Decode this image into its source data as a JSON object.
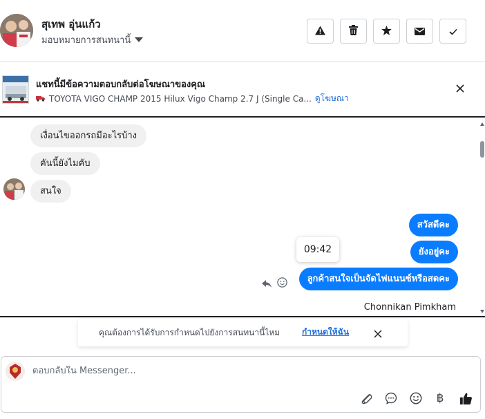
{
  "header": {
    "contact_name": "สุเทพ อุ่นแก้ว",
    "assign_label": "มอบหมายการสนทนานี้",
    "actions": [
      {
        "name": "report",
        "icon": "warning-icon"
      },
      {
        "name": "delete",
        "icon": "trash-icon"
      },
      {
        "name": "star",
        "icon": "star-icon"
      },
      {
        "name": "mark-unread",
        "icon": "envelope-icon"
      },
      {
        "name": "mark-done",
        "icon": "check-icon"
      }
    ]
  },
  "ad_banner": {
    "title": "แชทนี้มีข้อความตอบกลับต่อโฆษณาของคุณ",
    "subtitle": "TOYOTA VIGO CHAMP 2015 Hilux Vigo Champ 2.7 J (Single Ca...",
    "link": "ดูโฆษณา"
  },
  "messages": {
    "incoming": [
      "เงื่อนไขออกรถมีอะไรบ้าง",
      "คันนี้ยังไมคับ",
      "สนใจ"
    ],
    "outgoing": [
      "สวัสดีคะ",
      "ยังอยู่คะ",
      "ลูกค้าสนใจเป็นจัดไฟแนนซ์หรือสดคะ"
    ],
    "timestamp": "09:42",
    "sender_name": "Chonnikan Pimkham"
  },
  "toast": {
    "text": "คุณต้องการได้รับการกำหนดไปยังการสนทนานี้ไหม",
    "link": "กำหนดให้ฉัน"
  },
  "composer": {
    "placeholder": "ตอบกลับใน Messenger...",
    "currency_symbol": "฿"
  },
  "colors": {
    "accent": "#0a7cff",
    "link": "#216fdb",
    "incoming_bubble": "#f0f0f0"
  }
}
